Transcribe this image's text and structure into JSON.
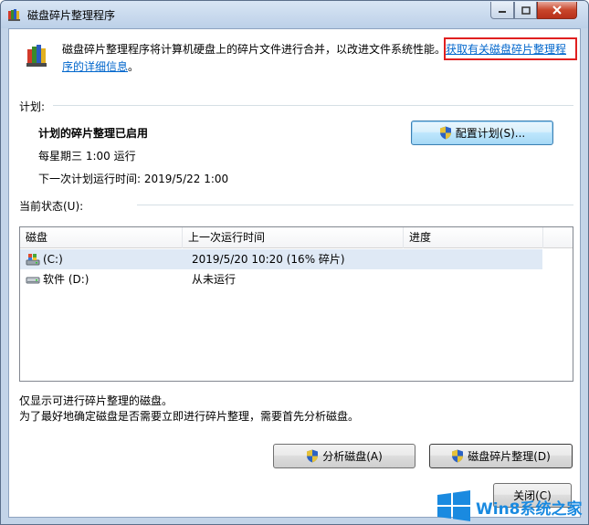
{
  "window": {
    "title": "磁盘碎片整理程序",
    "accent": "#0066cc",
    "highlight_box_color": "#e02020"
  },
  "header": {
    "description": "磁盘碎片整理程序将计算机硬盘上的碎片文件进行合并，以改进文件系统性能。",
    "link_part1": "获取有关磁盘碎片整理程",
    "link_part2": "序的详细信息",
    "link_suffix": "。"
  },
  "schedule": {
    "section_label": "计划:",
    "status": "计划的碎片整理已启用",
    "frequency": "每星期三  1:00 运行",
    "next_run": "下一次计划运行时间: 2019/5/22 1:00",
    "configure_button": "配置计划(S)..."
  },
  "current_status": {
    "section_label": "当前状态(U):",
    "columns": [
      "磁盘",
      "上一次运行时间",
      "进度"
    ],
    "rows": [
      {
        "disk": "(C:)",
        "last_run": "2019/5/20 10:20 (16% 碎片)",
        "progress": "",
        "icon": "system-drive-icon",
        "selected": true
      },
      {
        "disk": "软件 (D:)",
        "last_run": "从未运行",
        "progress": "",
        "icon": "drive-icon",
        "selected": false
      }
    ]
  },
  "notes": {
    "line1": "仅显示可进行碎片整理的磁盘。",
    "line2": "为了最好地确定磁盘是否需要立即进行碎片整理，需要首先分析磁盘。"
  },
  "actions": {
    "analyze_button": "分析磁盘(A)",
    "defrag_button": "磁盘碎片整理(D)",
    "close_button": "关闭(C)"
  },
  "watermark": {
    "text": "Win8系统之家"
  }
}
